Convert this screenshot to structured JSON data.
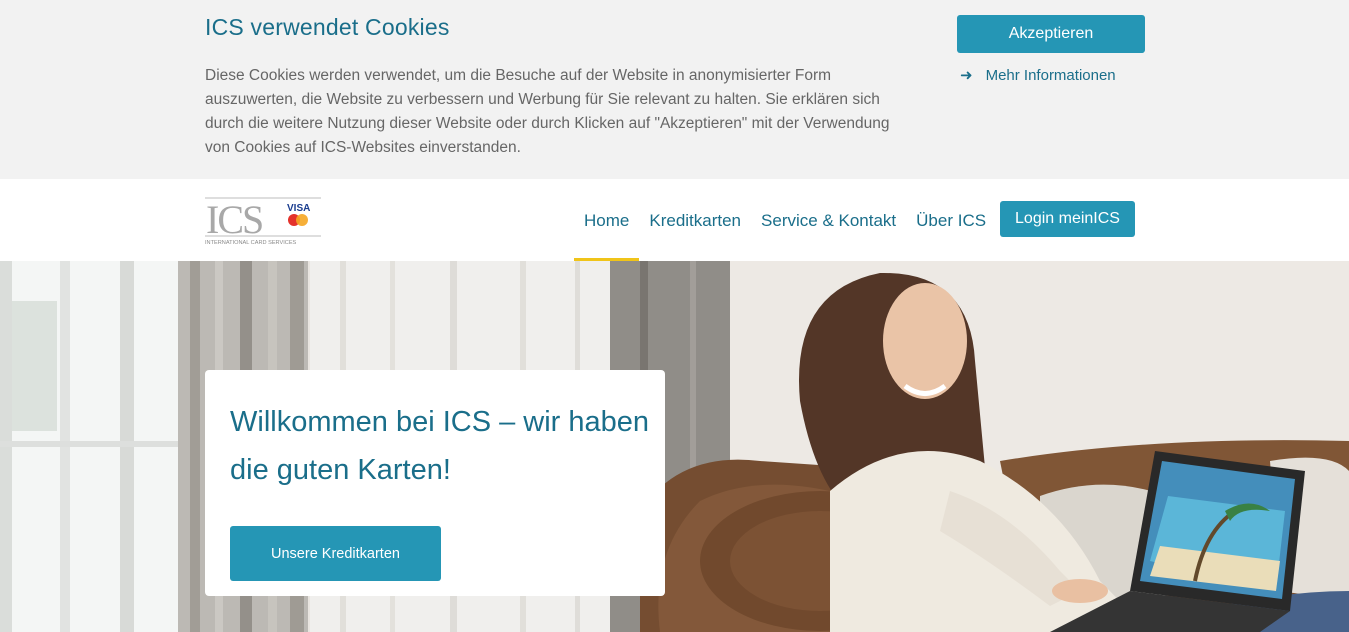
{
  "cookie_banner": {
    "title": "ICS verwendet Cookies",
    "text": "Diese Cookies werden verwendet, um die Besuche auf der Website in anonymisierter Form auszuwerten, die Website zu verbessern und Werbung für Sie relevant zu halten. Sie erklären sich durch die weitere Nutzung dieser Website oder durch Klicken auf \"Akzeptieren\" mit der Verwendung von Cookies auf ICS-Websites einverstanden.",
    "accept_label": "Akzeptieren",
    "more_info_label": "Mehr Informationen",
    "more_info_icon": "arrow-right-icon"
  },
  "header": {
    "logo": {
      "brand": "ICS",
      "card_brand": "VISA",
      "tagline": "INTERNATIONAL CARD SERVICES"
    },
    "nav": [
      {
        "label": "Home",
        "active": true
      },
      {
        "label": "Kreditkarten",
        "active": false
      },
      {
        "label": "Service & Kontakt",
        "active": false
      },
      {
        "label": "Über ICS",
        "active": false
      }
    ],
    "login_label": "Login meinICS"
  },
  "hero": {
    "welcome_title": "Willkommen bei ICS – wir haben die guten Karten!",
    "cta_label": "Unsere Kreditkarten"
  },
  "colors": {
    "brand_teal": "#1a6e8a",
    "button_blue": "#2596b5",
    "nav_active_underline": "#f0c419",
    "banner_bg": "#f2f2f2"
  }
}
